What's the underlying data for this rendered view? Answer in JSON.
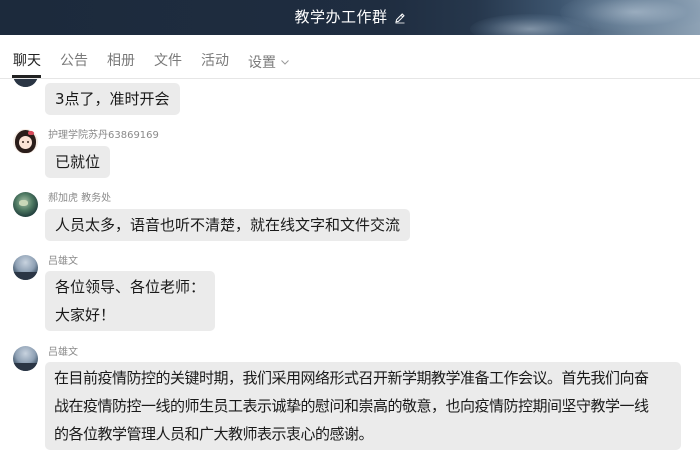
{
  "header": {
    "title": "教学办工作群",
    "edit_icon": "pencil-icon"
  },
  "tabs": [
    {
      "label": "聊天",
      "active": true
    },
    {
      "label": "公告"
    },
    {
      "label": "相册"
    },
    {
      "label": "文件"
    },
    {
      "label": "活动"
    },
    {
      "label": "设置",
      "has_dropdown": true
    }
  ],
  "messages": [
    {
      "sender": "",
      "avatar": "sky-avatar",
      "lines": [
        "3点了，准时开会"
      ]
    },
    {
      "sender": "护理学院苏丹63869169",
      "avatar": "girl-avatar",
      "lines": [
        "已就位"
      ]
    },
    {
      "sender": "郝加虎 教务处",
      "avatar": "globe-avatar",
      "lines": [
        "人员太多，语音也听不清楚，就在线文字和文件交流"
      ]
    },
    {
      "sender": "吕雄文",
      "avatar": "sky-avatar",
      "lines": [
        "各位领导、各位老师：",
        "大家好！"
      ]
    },
    {
      "sender": "吕雄文",
      "avatar": "sky-avatar",
      "lines": [
        "在目前疫情防控的关键时期，我们采用网络形式召开新学期教学准备工作会议。首先我们向奋",
        "战在疫情防控一线的师生员工表示诚挚的慰问和崇高的敬意，也向疫情防控期间坚守教学一线",
        "的各位教学管理人员和广大教师表示衷心的感谢。"
      ]
    }
  ],
  "colors": {
    "bubble": "#ebebeb",
    "header_dark": "#1f2d40",
    "tab_active": "#222222",
    "tab_inactive": "#7a7a7a"
  }
}
